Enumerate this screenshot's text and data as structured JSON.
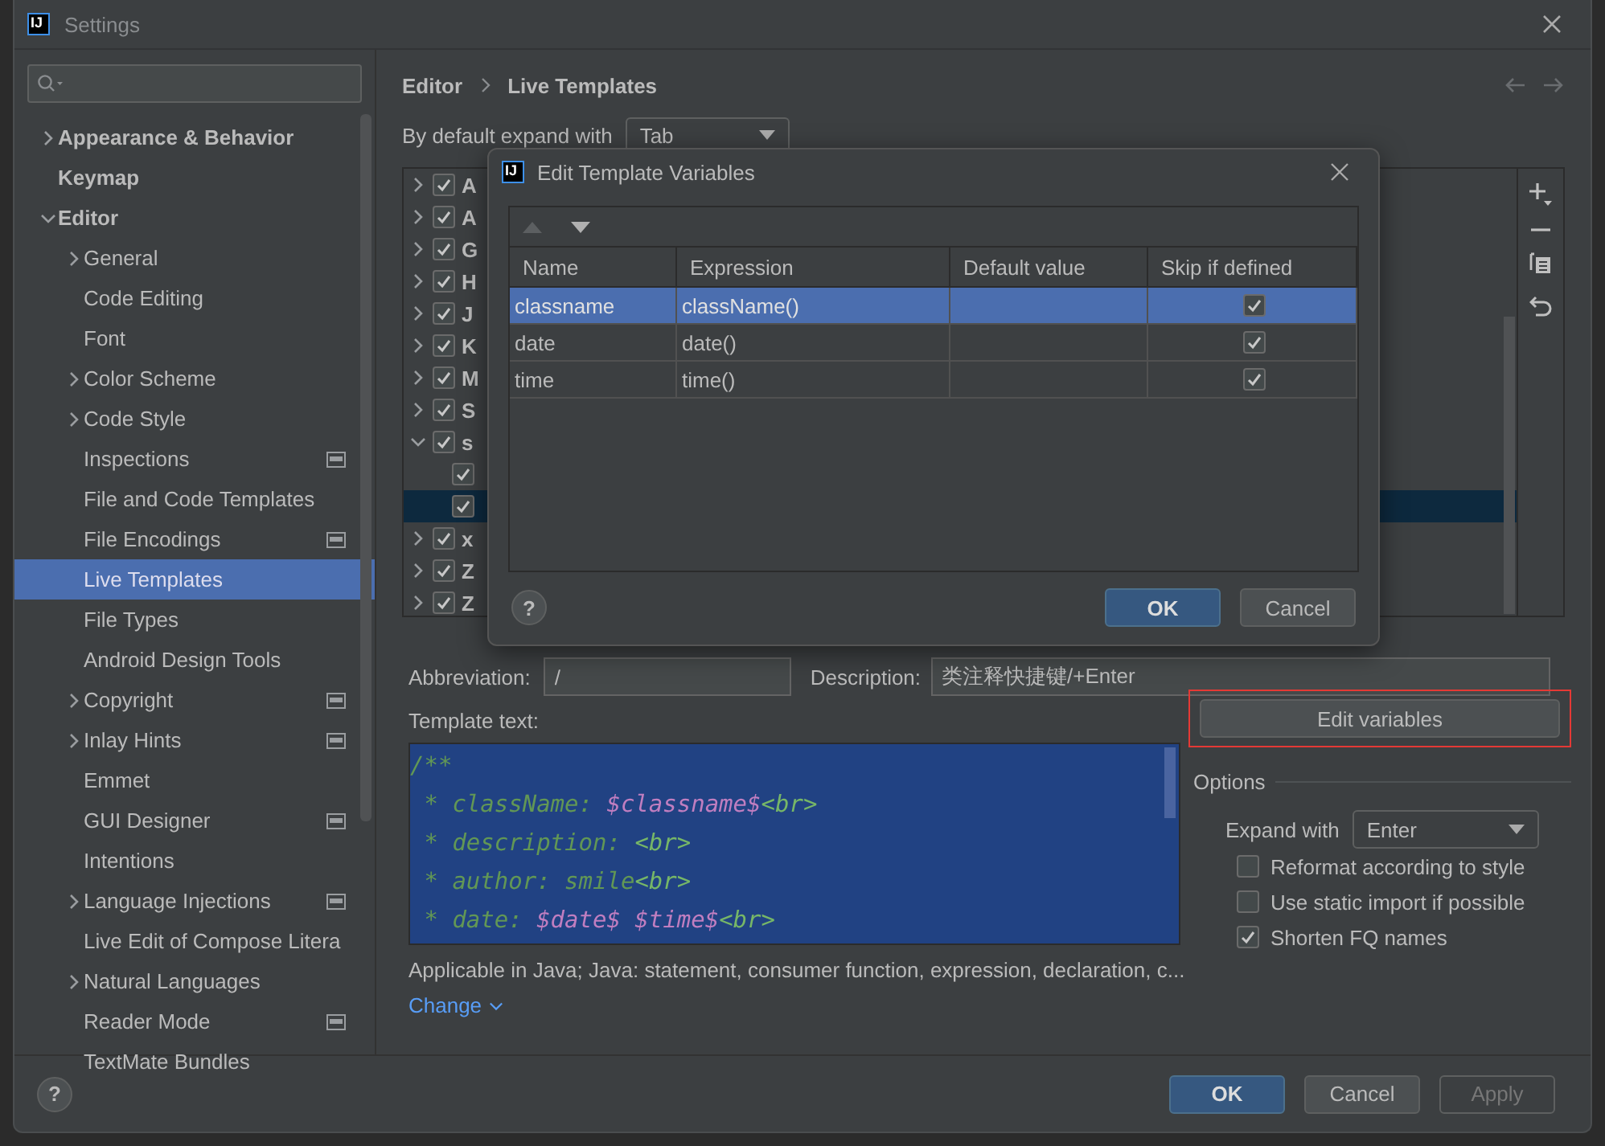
{
  "window": {
    "title": "Settings",
    "icon_text": "IJ"
  },
  "sidebar": {
    "items": [
      {
        "label": "Appearance & Behavior",
        "expanded": false,
        "scoped": false,
        "selected": false
      },
      {
        "label": "Keymap",
        "scoped": false,
        "selected": false
      },
      {
        "label": "Editor",
        "expanded": true,
        "scoped": false,
        "selected": false,
        "children": [
          {
            "label": "General",
            "expanded": false,
            "scoped": false,
            "selected": false
          },
          {
            "label": "Code Editing",
            "scoped": false,
            "selected": false
          },
          {
            "label": "Font",
            "scoped": false,
            "selected": false
          },
          {
            "label": "Color Scheme",
            "expanded": false,
            "scoped": false,
            "selected": false
          },
          {
            "label": "Code Style",
            "expanded": false,
            "scoped": false,
            "selected": false
          },
          {
            "label": "Inspections",
            "scoped": true,
            "selected": false
          },
          {
            "label": "File and Code Templates",
            "scoped": false,
            "selected": false
          },
          {
            "label": "File Encodings",
            "scoped": true,
            "selected": false
          },
          {
            "label": "Live Templates",
            "scoped": false,
            "selected": true
          },
          {
            "label": "File Types",
            "scoped": false,
            "selected": false
          },
          {
            "label": "Android Design Tools",
            "scoped": false,
            "selected": false
          },
          {
            "label": "Copyright",
            "expanded": false,
            "scoped": true,
            "selected": false
          },
          {
            "label": "Inlay Hints",
            "expanded": false,
            "scoped": true,
            "selected": false
          },
          {
            "label": "Emmet",
            "scoped": false,
            "selected": false
          },
          {
            "label": "GUI Designer",
            "scoped": true,
            "selected": false
          },
          {
            "label": "Intentions",
            "scoped": false,
            "selected": false
          },
          {
            "label": "Language Injections",
            "expanded": false,
            "scoped": true,
            "selected": false
          },
          {
            "label": "Live Edit of Compose Litera",
            "scoped": false,
            "selected": false
          },
          {
            "label": "Natural Languages",
            "expanded": false,
            "scoped": false,
            "selected": false
          },
          {
            "label": "Reader Mode",
            "scoped": true,
            "selected": false
          },
          {
            "label": "TextMate Bundles",
            "scoped": false,
            "selected": false
          }
        ]
      }
    ]
  },
  "breadcrumb": [
    "Editor",
    "Live Templates"
  ],
  "expand_default": {
    "label": "By default expand with",
    "value": "Tab"
  },
  "templates": [
    {
      "label": "A",
      "checked": true,
      "expanded": false,
      "selected": false
    },
    {
      "label": "A",
      "checked": true,
      "expanded": false,
      "selected": false
    },
    {
      "label": "G",
      "checked": true,
      "expanded": false,
      "selected": false
    },
    {
      "label": "H",
      "checked": true,
      "expanded": false,
      "selected": false
    },
    {
      "label": "J",
      "checked": true,
      "expanded": false,
      "selected": false
    },
    {
      "label": "K",
      "checked": true,
      "expanded": false,
      "selected": false
    },
    {
      "label": "M",
      "checked": true,
      "expanded": false,
      "selected": false
    },
    {
      "label": "S",
      "checked": true,
      "expanded": false,
      "selected": false
    },
    {
      "label": "s",
      "checked": true,
      "expanded": true,
      "selected": false,
      "children": [
        {
          "checked": true,
          "selected": false
        },
        {
          "checked": true,
          "selected": true
        }
      ]
    },
    {
      "label": "x",
      "checked": true,
      "expanded": false,
      "selected": false
    },
    {
      "label": "Z",
      "checked": true,
      "expanded": false,
      "selected": false
    },
    {
      "label": "Z",
      "checked": true,
      "expanded": false,
      "selected": false
    }
  ],
  "abbreviation": {
    "label": "Abbreviation:",
    "value": "/"
  },
  "description": {
    "label": "Description:",
    "value": "类注释快捷键/+Enter"
  },
  "template_text": {
    "label": "Template text:",
    "lines": [
      [
        {
          "text": "/**",
          "kind": "comment"
        }
      ],
      [
        {
          "text": " * className: ",
          "kind": "comment"
        },
        {
          "text": "$classname$",
          "kind": "variable"
        },
        {
          "text": "<br>",
          "kind": "tag"
        }
      ],
      [
        {
          "text": " * description: ",
          "kind": "comment"
        },
        {
          "text": "<br>",
          "kind": "tag"
        }
      ],
      [
        {
          "text": " * author: smile",
          "kind": "comment"
        },
        {
          "text": "<br>",
          "kind": "tag"
        }
      ],
      [
        {
          "text": " * date: ",
          "kind": "comment"
        },
        {
          "text": "$date$ $time$",
          "kind": "variable"
        },
        {
          "text": "<br>",
          "kind": "tag"
        }
      ]
    ]
  },
  "applicable": "Applicable in Java; Java: statement, consumer function, expression, declaration, c...",
  "change_link": "Change",
  "edit_variables": {
    "label": "Edit variables",
    "highlighted": true
  },
  "options": {
    "title": "Options",
    "expand_with": {
      "label": "Expand with",
      "value": "Enter"
    },
    "checkboxes": [
      {
        "label": "Reformat according to style",
        "checked": false
      },
      {
        "label": "Use static import if possible",
        "checked": false
      },
      {
        "label": "Shorten FQ names",
        "checked": true
      }
    ]
  },
  "footer": {
    "help": "?",
    "buttons": [
      {
        "label": "OK",
        "kind": "primary",
        "disabled": false
      },
      {
        "label": "Cancel",
        "kind": "normal",
        "disabled": false
      },
      {
        "label": "Apply",
        "kind": "normal",
        "disabled": true
      }
    ]
  },
  "dialog": {
    "title": "Edit Template Variables",
    "icon_text": "IJ",
    "columns": [
      "Name",
      "Expression",
      "Default value",
      "Skip if defined"
    ],
    "rows": [
      {
        "name": "classname",
        "expression": "className()",
        "selected": true,
        "skip_if_defined": true
      },
      {
        "name": "date",
        "expression": "date()",
        "selected": false,
        "skip_if_defined": true
      },
      {
        "name": "time",
        "expression": "time()",
        "selected": false,
        "skip_if_defined": true
      }
    ],
    "help": "?",
    "buttons": [
      {
        "label": "OK",
        "kind": "primary"
      },
      {
        "label": "Cancel",
        "kind": "normal"
      }
    ]
  }
}
